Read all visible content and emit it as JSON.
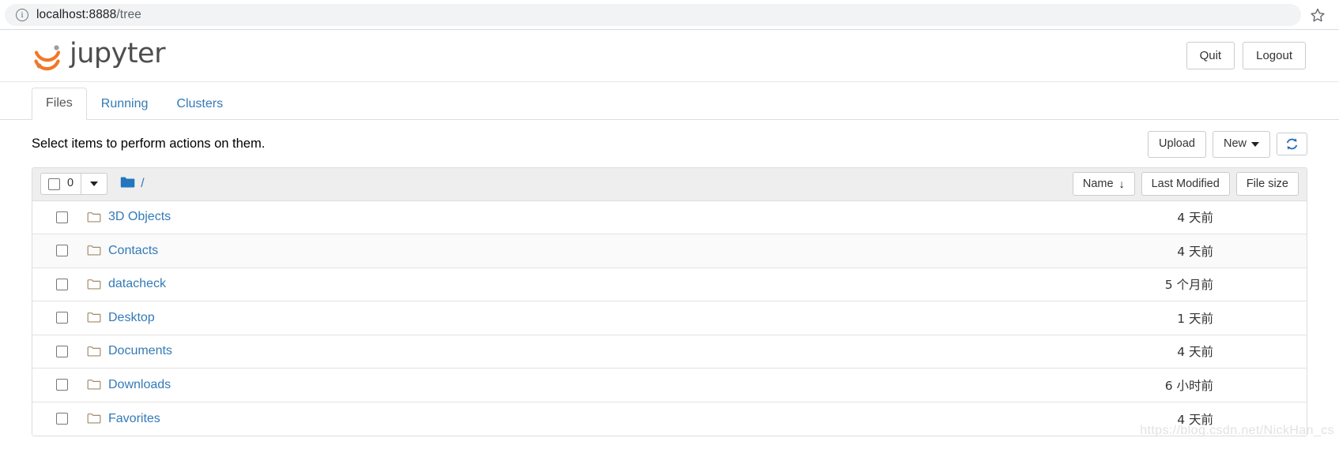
{
  "browser": {
    "url_prefix": "localhost:8888",
    "url_suffix": "/tree",
    "info_icon": "info-icon",
    "bookmark_icon": "star-icon"
  },
  "header": {
    "logo_text": "jupyter",
    "logo_icon": "jupyter-logo-icon",
    "quit_label": "Quit",
    "logout_label": "Logout"
  },
  "tabs": [
    {
      "label": "Files",
      "active": true
    },
    {
      "label": "Running",
      "active": false
    },
    {
      "label": "Clusters",
      "active": false
    }
  ],
  "toolbar": {
    "hint": "Select items to perform actions on them.",
    "upload_label": "Upload",
    "new_label": "New",
    "refresh_icon": "refresh-icon",
    "dropdown_icon": "chevron-down-icon"
  },
  "list_header": {
    "selected_count": "0",
    "select_all_checkbox": "select-all-checkbox",
    "breadcrumb_icon": "folder-icon",
    "breadcrumb_path": "/",
    "sort_name": "Name",
    "sort_name_arrow": "↓",
    "sort_last_modified": "Last Modified",
    "sort_file_size": "File size"
  },
  "files": [
    {
      "name": "3D Objects",
      "modified": "4 天前",
      "size": "",
      "icon": "folder-outline-icon"
    },
    {
      "name": "Contacts",
      "modified": "4 天前",
      "size": "",
      "icon": "folder-outline-icon"
    },
    {
      "name": "datacheck",
      "modified": "5 个月前",
      "size": "",
      "icon": "folder-outline-icon"
    },
    {
      "name": "Desktop",
      "modified": "1 天前",
      "size": "",
      "icon": "folder-outline-icon"
    },
    {
      "name": "Documents",
      "modified": "4 天前",
      "size": "",
      "icon": "folder-outline-icon"
    },
    {
      "name": "Downloads",
      "modified": "6 小时前",
      "size": "",
      "icon": "folder-outline-icon"
    },
    {
      "name": "Favorites",
      "modified": "4 天前",
      "size": "",
      "icon": "folder-outline-icon"
    }
  ],
  "watermark": "https://blog.csdn.net/NickHan_cs",
  "colors": {
    "link": "#337ab7",
    "logo_orange": "#f37726",
    "logo_gray": "#9e9e9e",
    "folder_blue": "#2176bd",
    "header_bg": "#eeeeee"
  }
}
